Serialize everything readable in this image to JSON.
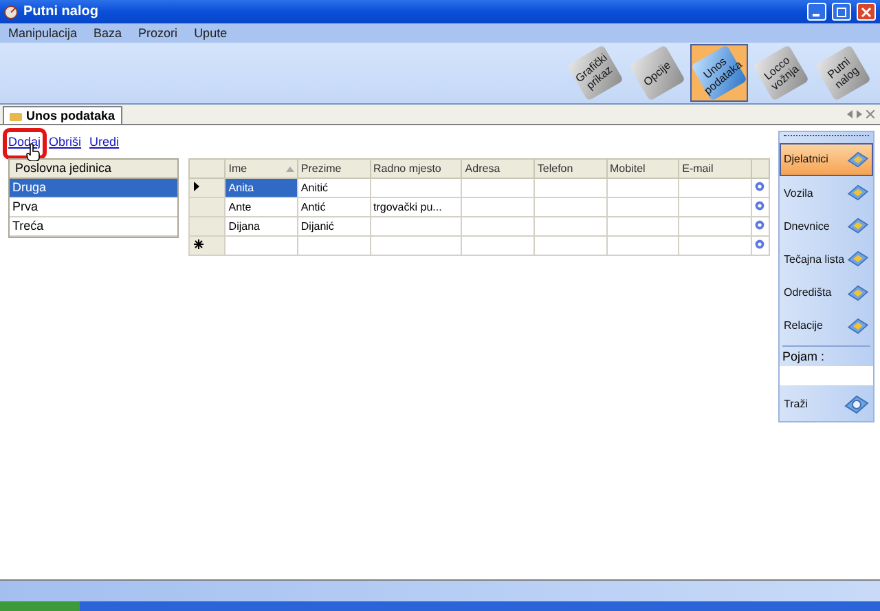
{
  "window": {
    "title": "Putni nalog"
  },
  "menu": [
    "Manipulacija",
    "Baza",
    "Prozori",
    "Upute"
  ],
  "toolbar": [
    {
      "label": "Grafički prikaz",
      "selected": false
    },
    {
      "label": "Opcije",
      "selected": false
    },
    {
      "label": "Unos podataka",
      "selected": true
    },
    {
      "label": "Locco vožnja",
      "selected": false
    },
    {
      "label": "Putni nalog",
      "selected": false
    }
  ],
  "document_tab": {
    "title": "Unos podataka"
  },
  "actions": [
    {
      "label": "Dodaj",
      "highlighted": true
    },
    {
      "label": "Obriši",
      "highlighted": false
    },
    {
      "label": "Uredi",
      "highlighted": false
    }
  ],
  "units": {
    "header": "Poslovna jedinica",
    "rows": [
      {
        "label": "Druga",
        "selected": true
      },
      {
        "label": "Prva",
        "selected": false
      },
      {
        "label": "Treća",
        "selected": false
      }
    ]
  },
  "grid": {
    "columns": [
      {
        "label": "Ime",
        "sorted": true
      },
      {
        "label": "Prezime",
        "sorted": false
      },
      {
        "label": "Radno mjesto",
        "sorted": false
      },
      {
        "label": "Adresa",
        "sorted": false
      },
      {
        "label": "Telefon",
        "sorted": false
      },
      {
        "label": "Mobitel",
        "sorted": false
      },
      {
        "label": "E-mail",
        "sorted": false
      }
    ],
    "rows": [
      {
        "kind": "current",
        "selected": true,
        "cells": [
          "Anita",
          "Anitić",
          "",
          "",
          "",
          "",
          ""
        ]
      },
      {
        "kind": "plain",
        "selected": false,
        "cells": [
          "Ante",
          "Antić",
          "trgovački pu...",
          "",
          "",
          "",
          ""
        ]
      },
      {
        "kind": "plain",
        "selected": false,
        "cells": [
          "Dijana",
          "Dijanić",
          "",
          "",
          "",
          "",
          ""
        ]
      },
      {
        "kind": "new",
        "selected": false,
        "cells": [
          "",
          "",
          "",
          "",
          "",
          "",
          ""
        ]
      }
    ]
  },
  "sidebar": {
    "items": [
      {
        "label": "Djelatnici",
        "selected": true
      },
      {
        "label": "Vozila",
        "selected": false
      },
      {
        "label": "Dnevnice",
        "selected": false
      },
      {
        "label": "Tečajna lista",
        "selected": false
      },
      {
        "label": "Odredišta",
        "selected": false
      },
      {
        "label": "Relacije",
        "selected": false
      }
    ],
    "search_label": "Pojam :",
    "search_button": "Traži"
  }
}
